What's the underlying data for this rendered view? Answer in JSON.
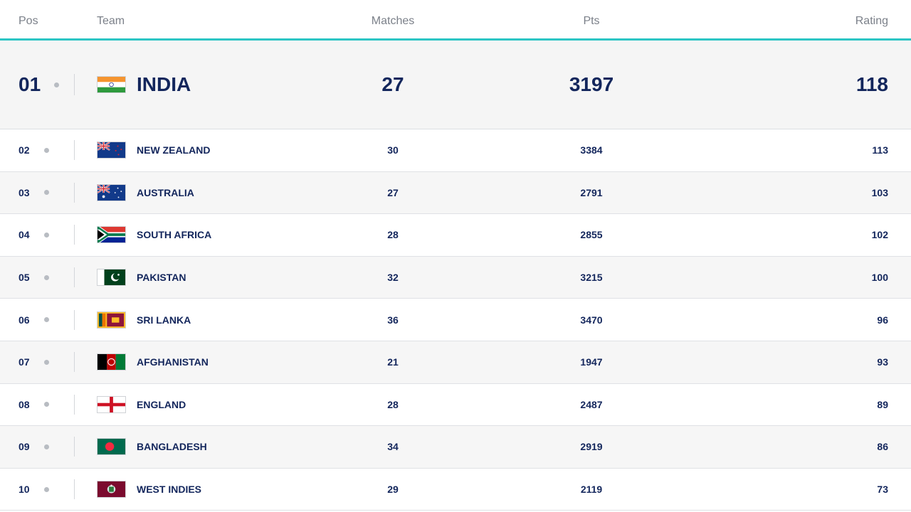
{
  "table": {
    "headers": {
      "pos": "Pos",
      "team": "Team",
      "matches": "Matches",
      "pts": "Pts",
      "rating": "Rating"
    },
    "rows": [
      {
        "pos": "01",
        "team": "INDIA",
        "matches": "27",
        "pts": "3197",
        "rating": "118",
        "flag": "india-flag"
      },
      {
        "pos": "02",
        "team": "NEW ZEALAND",
        "matches": "30",
        "pts": "3384",
        "rating": "113",
        "flag": "new-zealand-flag"
      },
      {
        "pos": "03",
        "team": "AUSTRALIA",
        "matches": "27",
        "pts": "2791",
        "rating": "103",
        "flag": "australia-flag"
      },
      {
        "pos": "04",
        "team": "SOUTH AFRICA",
        "matches": "28",
        "pts": "2855",
        "rating": "102",
        "flag": "south-africa-flag"
      },
      {
        "pos": "05",
        "team": "PAKISTAN",
        "matches": "32",
        "pts": "3215",
        "rating": "100",
        "flag": "pakistan-flag"
      },
      {
        "pos": "06",
        "team": "SRI LANKA",
        "matches": "36",
        "pts": "3470",
        "rating": "96",
        "flag": "sri-lanka-flag"
      },
      {
        "pos": "07",
        "team": "AFGHANISTAN",
        "matches": "21",
        "pts": "1947",
        "rating": "93",
        "flag": "afghanistan-flag"
      },
      {
        "pos": "08",
        "team": "ENGLAND",
        "matches": "28",
        "pts": "2487",
        "rating": "89",
        "flag": "england-flag"
      },
      {
        "pos": "09",
        "team": "BANGLADESH",
        "matches": "34",
        "pts": "2919",
        "rating": "86",
        "flag": "bangladesh-flag"
      },
      {
        "pos": "10",
        "team": "WEST INDIES",
        "matches": "29",
        "pts": "2119",
        "rating": "73",
        "flag": "west-indies-flag"
      }
    ]
  },
  "colors": {
    "text": "#13265c",
    "header_text": "#7b8089",
    "accent": "#2cc5c4",
    "dot": "#b8bcc2"
  }
}
